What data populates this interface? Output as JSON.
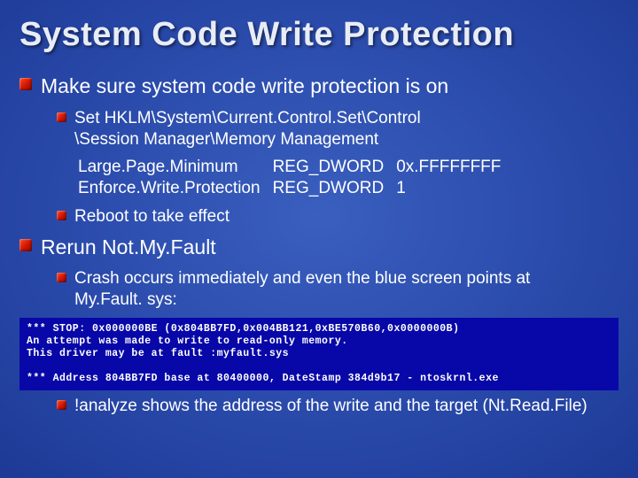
{
  "title": "System Code Write Protection",
  "p1": "Make sure system code write protection is on",
  "p1a_l1": "Set HKLM\\System\\Current.Control.Set\\Control",
  "p1a_l2": "\\Session Manager\\Memory Management",
  "reg": {
    "r1c1": "Large.Page.Minimum",
    "r1c2": "REG_DWORD",
    "r1c3": "0x.FFFFFFFF",
    "r2c1": "Enforce.Write.Protection",
    "r2c2": "REG_DWORD",
    "r2c3": "1"
  },
  "p1b": "Reboot to take effect",
  "p2": "Rerun Not.My.Fault",
  "p2a_l1": "Crash occurs immediately and even the blue screen points at",
  "p2a_l2": "My.Fault. sys:",
  "bsod_l1": "*** STOP: 0x000000BE (0x804BB7FD,0x004BB121,0xBE570B60,0x0000000B)",
  "bsod_l2": "An attempt was made to write to read-only memory.",
  "bsod_l3": "This driver may be at fault :myfault.sys",
  "bsod_l4": "",
  "bsod_l5": "*** Address 804BB7FD base at 80400000, DateStamp 384d9b17 - ntoskrnl.exe",
  "p2b": "!analyze shows the address of the write and the target (Nt.Read.File)"
}
